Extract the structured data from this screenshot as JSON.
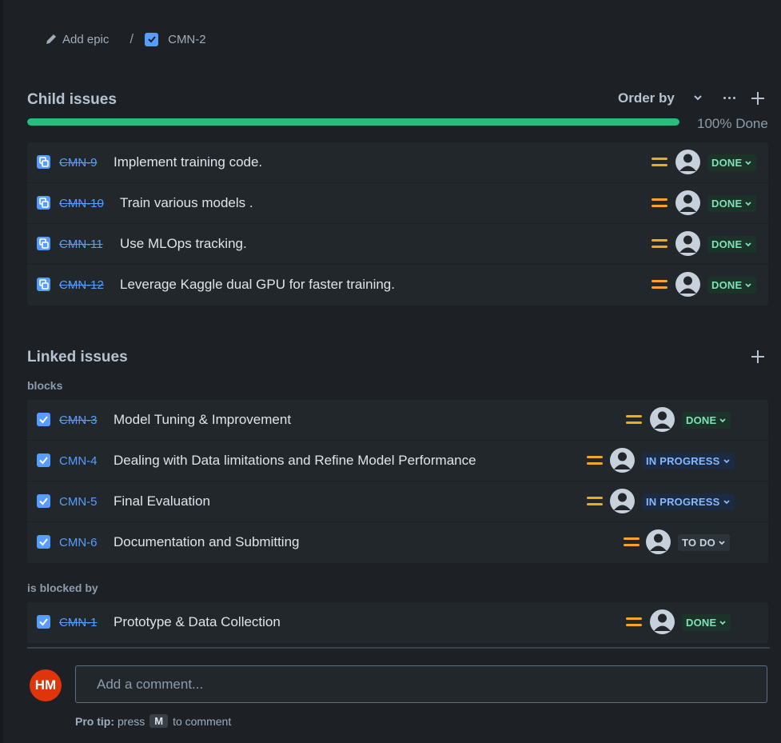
{
  "breadcrumb": {
    "add_epic_label": "Add epic",
    "separator": "/",
    "issue_key": "CMN-2",
    "check_color": "#579dff"
  },
  "child_issues": {
    "title": "Child issues",
    "order_by_label": "Order by",
    "progress_percent": 100,
    "progress_label": "100% Done",
    "progress_color": "#2abb7f",
    "items": [
      {
        "key": "CMN-9",
        "summary": "Implement training code.",
        "status": "DONE",
        "icon": "subtask-icon",
        "priority": "medium-priority-icon"
      },
      {
        "key": "CMN-10",
        "summary": "Train various models .",
        "status": "DONE",
        "icon": "subtask-icon",
        "priority": "medium-priority-icon"
      },
      {
        "key": "CMN-11",
        "summary": "Use MLOps tracking.",
        "status": "DONE",
        "icon": "subtask-icon",
        "priority": "medium-priority-icon"
      },
      {
        "key": "CMN-12",
        "summary": "Leverage Kaggle dual GPU for faster training.",
        "status": "DONE",
        "icon": "subtask-icon",
        "priority": "medium-priority-icon"
      }
    ]
  },
  "linked_issues": {
    "title": "Linked issues",
    "blocks_label": "blocks",
    "blocks": [
      {
        "key": "CMN-3",
        "summary": "Model Tuning & Improvement",
        "status": "DONE",
        "icon": "task-checkbox-icon"
      },
      {
        "key": "CMN-4",
        "summary": "Dealing with Data limitations and Refine Model Performance",
        "status": "IN PROGRESS",
        "icon": "task-checkbox-icon"
      },
      {
        "key": "CMN-5",
        "summary": "Final Evaluation",
        "status": "IN PROGRESS",
        "icon": "task-checkbox-icon"
      },
      {
        "key": "CMN-6",
        "summary": "Documentation and Submitting",
        "status": "TO DO",
        "icon": "task-checkbox-icon"
      }
    ],
    "blocked_by_label": "is blocked by",
    "blocked_by": [
      {
        "key": "CMN-1",
        "summary": "Prototype & Data Collection",
        "status": "DONE",
        "icon": "task-checkbox-icon"
      }
    ]
  },
  "comment": {
    "user_initials": "HM",
    "avatar_color": "#de350b",
    "placeholder": "Add a comment...",
    "protip_label": "Pro tip:",
    "protip_press": "press",
    "protip_key": "M",
    "protip_suffix": "to comment"
  }
}
